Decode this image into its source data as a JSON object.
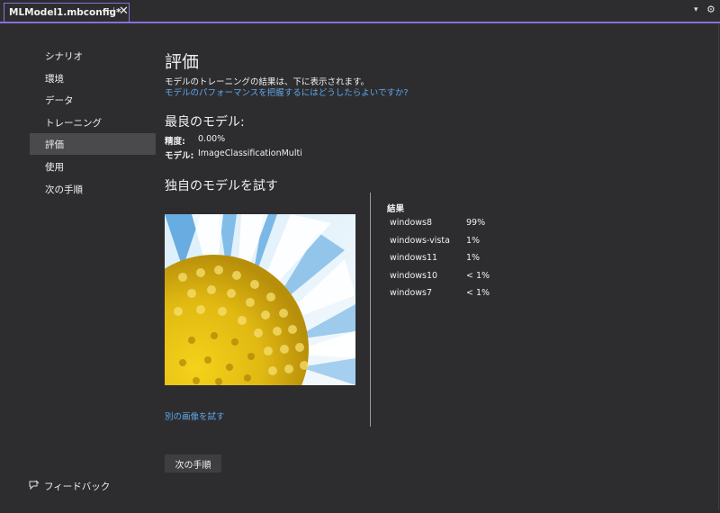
{
  "tab": {
    "title": "MLModel1.mbconfig*",
    "pin_glyph": "⊣",
    "close_glyph": "✕",
    "dropdown_glyph": "▾",
    "settings_glyph": "⚙"
  },
  "sidebar": {
    "items": [
      {
        "label": "シナリオ",
        "selected": false
      },
      {
        "label": "環境",
        "selected": false
      },
      {
        "label": "データ",
        "selected": false
      },
      {
        "label": "トレーニング",
        "selected": false
      },
      {
        "label": "評価",
        "selected": true
      },
      {
        "label": "使用",
        "selected": false
      },
      {
        "label": "次の手順",
        "selected": false
      }
    ],
    "feedback_label": "フィードバック"
  },
  "main": {
    "title": "評価",
    "description": "モデルのトレーニングの結果は、下に表示されます。",
    "help_link": "モデルのパフォーマンスを把握するにはどうしたらよいですか?",
    "best_model_title": "最良のモデル:",
    "metrics": [
      {
        "label": "精度:",
        "value": "0.00%"
      },
      {
        "label": "モデル:",
        "value": "ImageClassificationMulti"
      }
    ],
    "try_title": "独自のモデルを試す",
    "try_another_link": "別の画像を試す",
    "next_button": "次の手順"
  },
  "results": {
    "title": "結果",
    "rows": [
      {
        "label": "windows8",
        "value": "99%"
      },
      {
        "label": "windows-vista",
        "value": "1%"
      },
      {
        "label": "windows11",
        "value": "1%"
      },
      {
        "label": "windows10",
        "value": " < 1%"
      },
      {
        "label": "windows7",
        "value": " < 1%"
      }
    ]
  },
  "colors": {
    "accent": "#8c6fd6",
    "link": "#5fa7e8",
    "background": "#2d2d30",
    "selected": "#4a4a4d"
  }
}
